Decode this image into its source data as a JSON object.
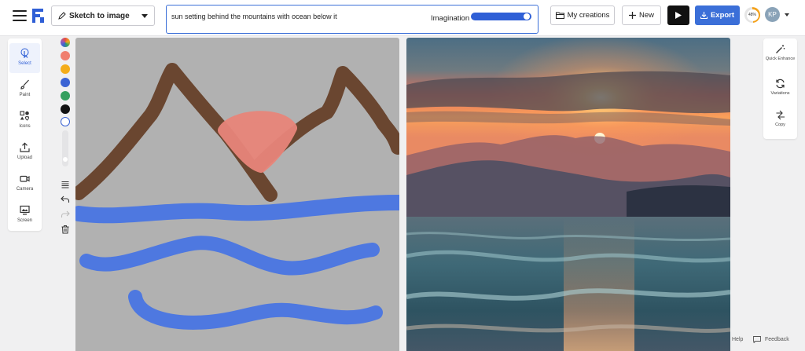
{
  "header": {
    "mode_select": {
      "label": "Sketch to image",
      "icon": "pen-icon"
    },
    "prompt": {
      "value": "sun setting behind the mountains with ocean below it",
      "placeholder": ""
    },
    "imagination": {
      "label": "Imagination",
      "level": 0.95
    },
    "buttons": {
      "my_creations": "My creations",
      "new": "New",
      "export": "Export"
    },
    "credits_percent": "48%",
    "avatar_initials": "KP"
  },
  "left_toolbar": {
    "items": [
      {
        "label": "Select",
        "icon": "pointer-icon"
      },
      {
        "label": "Paint",
        "icon": "brush-icon"
      },
      {
        "label": "Icons",
        "icon": "icons-icon"
      },
      {
        "label": "Upload",
        "icon": "upload-icon"
      },
      {
        "label": "Camera",
        "icon": "camera-icon"
      },
      {
        "label": "Screen",
        "icon": "screen-icon"
      }
    ]
  },
  "palette": {
    "colors": [
      "#f07f6e",
      "#f4ad1a",
      "#3b63d4",
      "#35a060",
      "#111111",
      "#ffffff"
    ]
  },
  "right_toolbar": {
    "items": [
      {
        "label": "Quick Enhance",
        "icon": "magic-wand-icon"
      },
      {
        "label": "Variations",
        "icon": "refresh-icon"
      },
      {
        "label": "Copy",
        "icon": "copy-icon"
      }
    ]
  },
  "footer": {
    "help": "Help",
    "feedback": "Feedback"
  },
  "colors": {
    "accent": "#3b6fd8",
    "sketch_background": "#b1b1b1"
  }
}
